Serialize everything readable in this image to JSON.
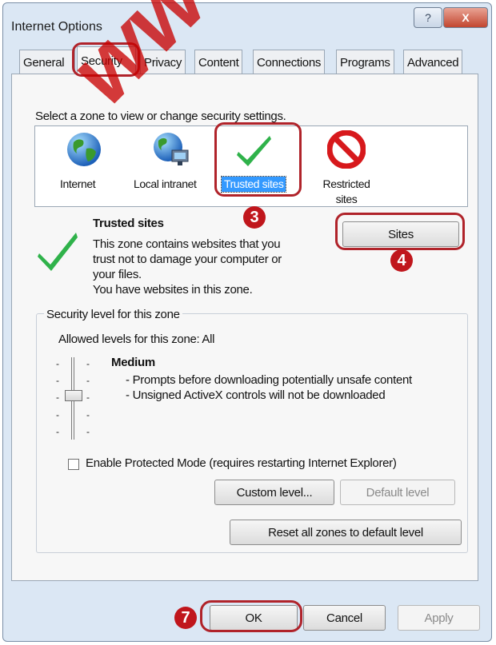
{
  "window": {
    "title": "Internet Options",
    "help_glyph": "?",
    "close_glyph": "X"
  },
  "tabs": [
    "General",
    "Security",
    "Privacy",
    "Content",
    "Connections",
    "Programs",
    "Advanced"
  ],
  "zones": {
    "prompt": "Select a zone to view or change security settings.",
    "items": [
      {
        "label": "Internet",
        "icon": "globe-icon"
      },
      {
        "label": "Local intranet",
        "icon": "network-globe-icon"
      },
      {
        "label": "Trusted sites",
        "icon": "green-checkmark-icon",
        "selected": true
      },
      {
        "label": "Restricted sites",
        "icon": "red-prohibited-icon"
      }
    ]
  },
  "zone_info": {
    "title": "Trusted sites",
    "line1": "This zone contains websites that you",
    "line2": "trust not to damage your computer or",
    "line3": "your files.",
    "line4": "You have websites in this zone.",
    "sites_button": "Sites"
  },
  "security_level": {
    "group_label": "Security level for this zone",
    "allowed": "Allowed levels for this zone: All",
    "level_name": "Medium",
    "bullet1": "- Prompts before downloading potentially unsafe content",
    "bullet2": "- Unsigned ActiveX controls will not be downloaded",
    "slider_level": "Medium",
    "protected_mode_label": "Enable Protected Mode (requires restarting Internet Explorer)",
    "protected_mode_checked": false,
    "custom_button": "Custom level...",
    "default_button": "Default level"
  },
  "reset_button": "Reset all zones to default level",
  "footer": {
    "ok": "OK",
    "cancel": "Cancel",
    "apply": "Apply"
  },
  "annotations": {
    "step3": "3",
    "step4": "4",
    "step7": "7"
  },
  "watermark": "www.atis",
  "colors": {
    "highlight_ring": "#b0232a",
    "badge": "#c0161c",
    "selection": "#3399ff"
  }
}
